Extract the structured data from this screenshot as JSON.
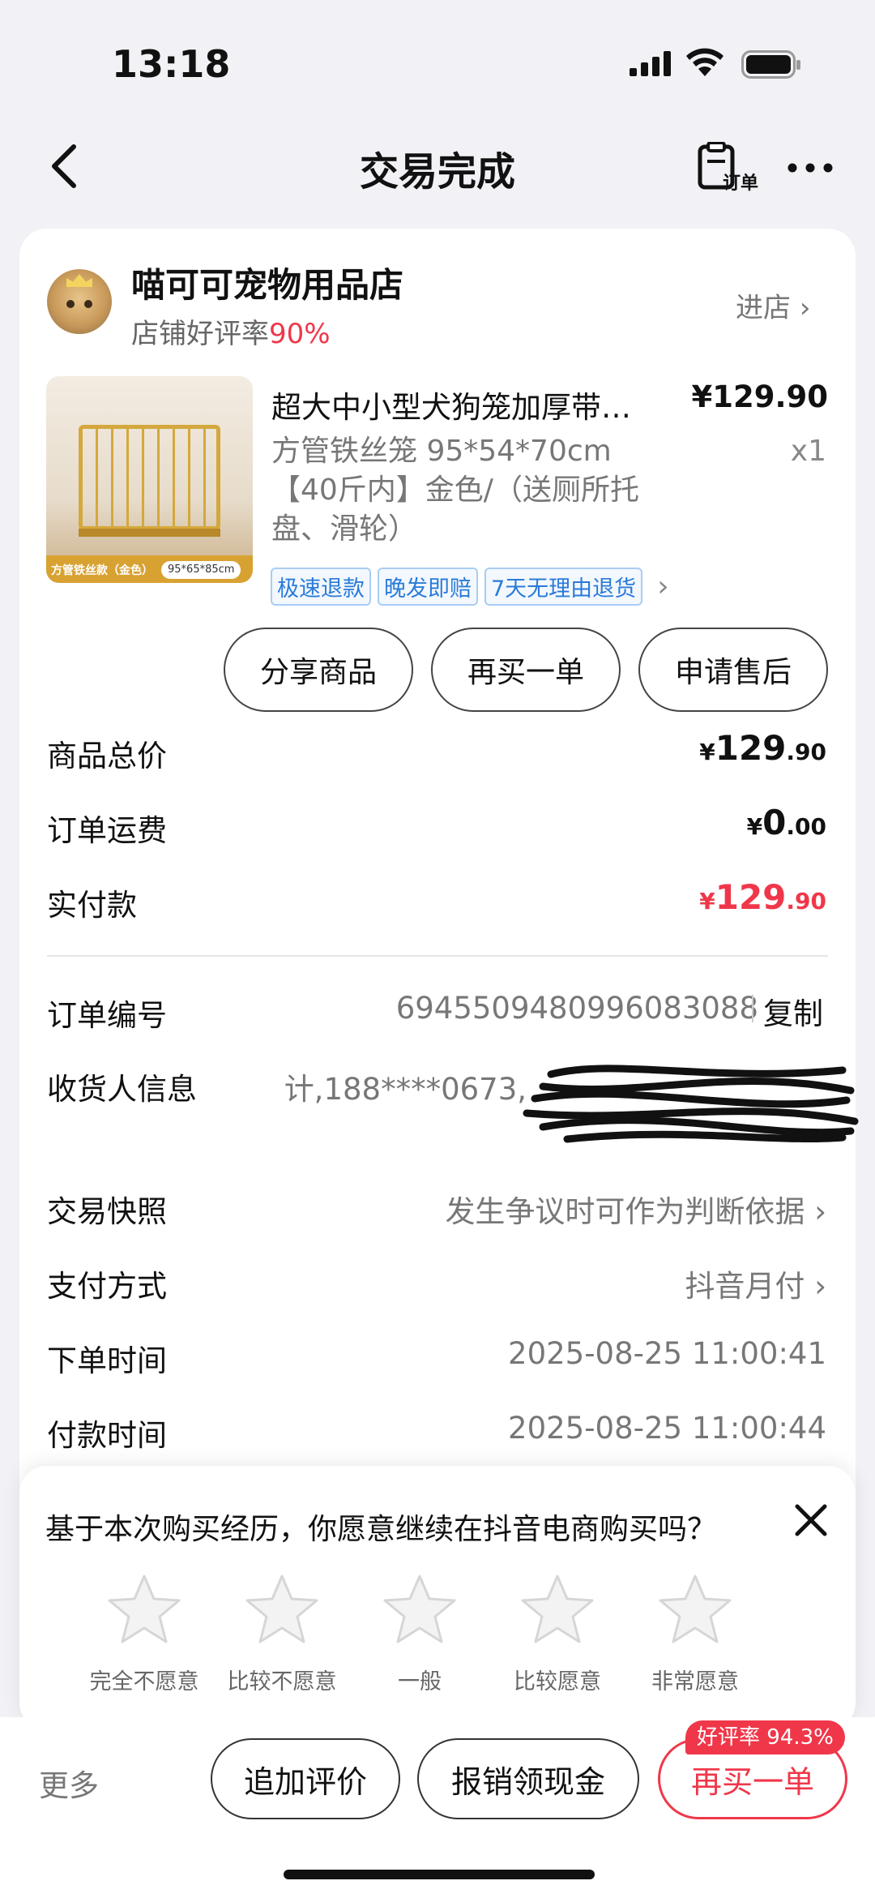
{
  "status": {
    "time": "13:18"
  },
  "nav": {
    "title": "交易完成",
    "order_label": "订单"
  },
  "shop": {
    "name": "喵可可宠物用品店",
    "rating_label": "店铺好评率",
    "rating_value": "90%",
    "enter": "进店"
  },
  "product": {
    "title": "超大中小型犬狗笼加厚带…",
    "price": "¥129.90",
    "spec": "方管铁丝笼 95*54*70cm 【40斤内】金色/（送厕所托盘、滑轮）",
    "qty": "x1",
    "image_tag_left": "方管铁丝款（金色）",
    "image_tag_right": "95*65*85cm",
    "tags": [
      "极速退款",
      "晚发即赔",
      "7天无理由退货"
    ]
  },
  "actions": {
    "share": "分享商品",
    "rebuy": "再买一单",
    "after_sale": "申请售后"
  },
  "summary": {
    "total_label": "商品总价",
    "total_y": "¥",
    "total_int": "129",
    "total_dec": ".90",
    "ship_label": "订单运费",
    "ship_y": "¥",
    "ship_int": "0",
    "ship_dec": ".00",
    "paid_label": "实付款",
    "paid_y": "¥",
    "paid_int": "129",
    "paid_dec": ".90"
  },
  "details": {
    "order_no_label": "订单编号",
    "order_no": "6945509480996083088",
    "copy": "复制",
    "receiver_label": "收货人信息",
    "receiver_value": "计,188****0673,",
    "snapshot_label": "交易快照",
    "snapshot_value": "发生争议时可作为判断依据",
    "pay_label": "支付方式",
    "pay_value": "抖音月付",
    "order_time_label": "下单时间",
    "order_time": "2025-08-25 11:00:41",
    "pay_time_label": "付款时间",
    "pay_time": "2025-08-25 11:00:44"
  },
  "survey": {
    "question": "基于本次购买经历，你愿意继续在抖音电商购买吗？",
    "options": [
      "完全不愿意",
      "比较不愿意",
      "一般",
      "比较愿意",
      "非常愿意"
    ]
  },
  "bottom": {
    "more": "更多",
    "add_review": "追加评价",
    "reimburse": "报销领现金",
    "rebuy": "再买一单",
    "badge": "好评率 94.3%"
  },
  "colors": {
    "accent": "#f0374a",
    "tag_blue": "#2a7bd8"
  }
}
